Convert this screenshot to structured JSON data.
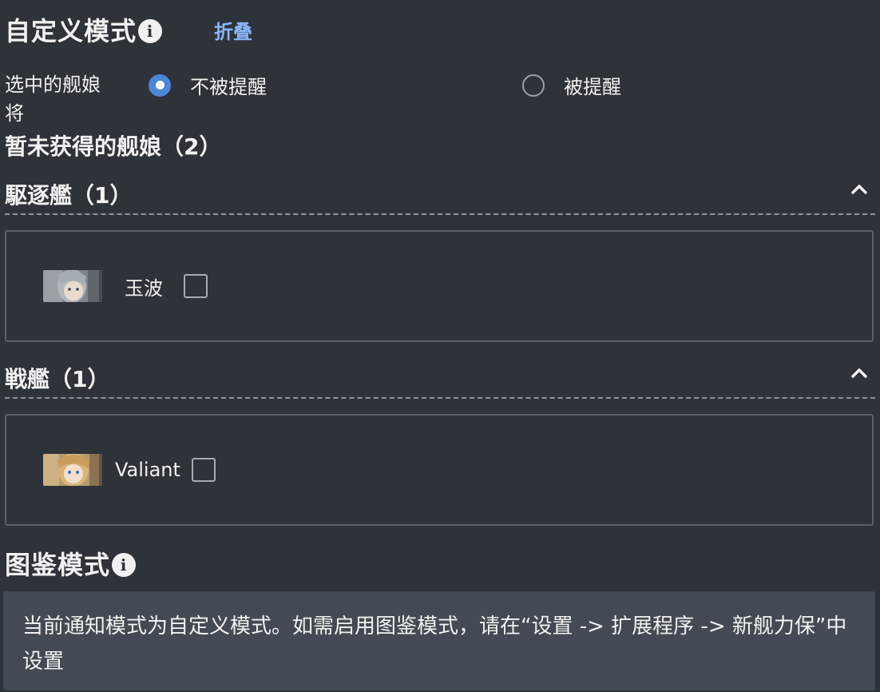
{
  "header": {
    "title": "自定义模式",
    "collapse_label": "折叠"
  },
  "notify_option": {
    "label": "选中的舰娘将",
    "options": [
      {
        "label": "不被提醒",
        "selected": true
      },
      {
        "label": "被提醒",
        "selected": false
      }
    ]
  },
  "unobtained_title": "暂未获得的舰娘（2）",
  "groups": [
    {
      "title": "駆逐艦（1）",
      "ships": [
        {
          "name": "玉波",
          "checked": false
        }
      ]
    },
    {
      "title": "戦艦（1）",
      "ships": [
        {
          "name": "Valiant",
          "checked": false
        }
      ]
    }
  ],
  "catalog_mode": {
    "title": "图鉴模式",
    "notice": "当前通知模式为自定义模式。如需启用图鉴模式，请在“设置 -> 扩展程序 -> 新舰力保”中设置"
  },
  "colors": {
    "background": "#2e3239",
    "accent": "#8ab4f8",
    "radio_selected": "#4d86d6",
    "notice_background": "#434a53"
  },
  "icons": {
    "info": "info-icon",
    "chevron": "chevron-up-icon"
  }
}
